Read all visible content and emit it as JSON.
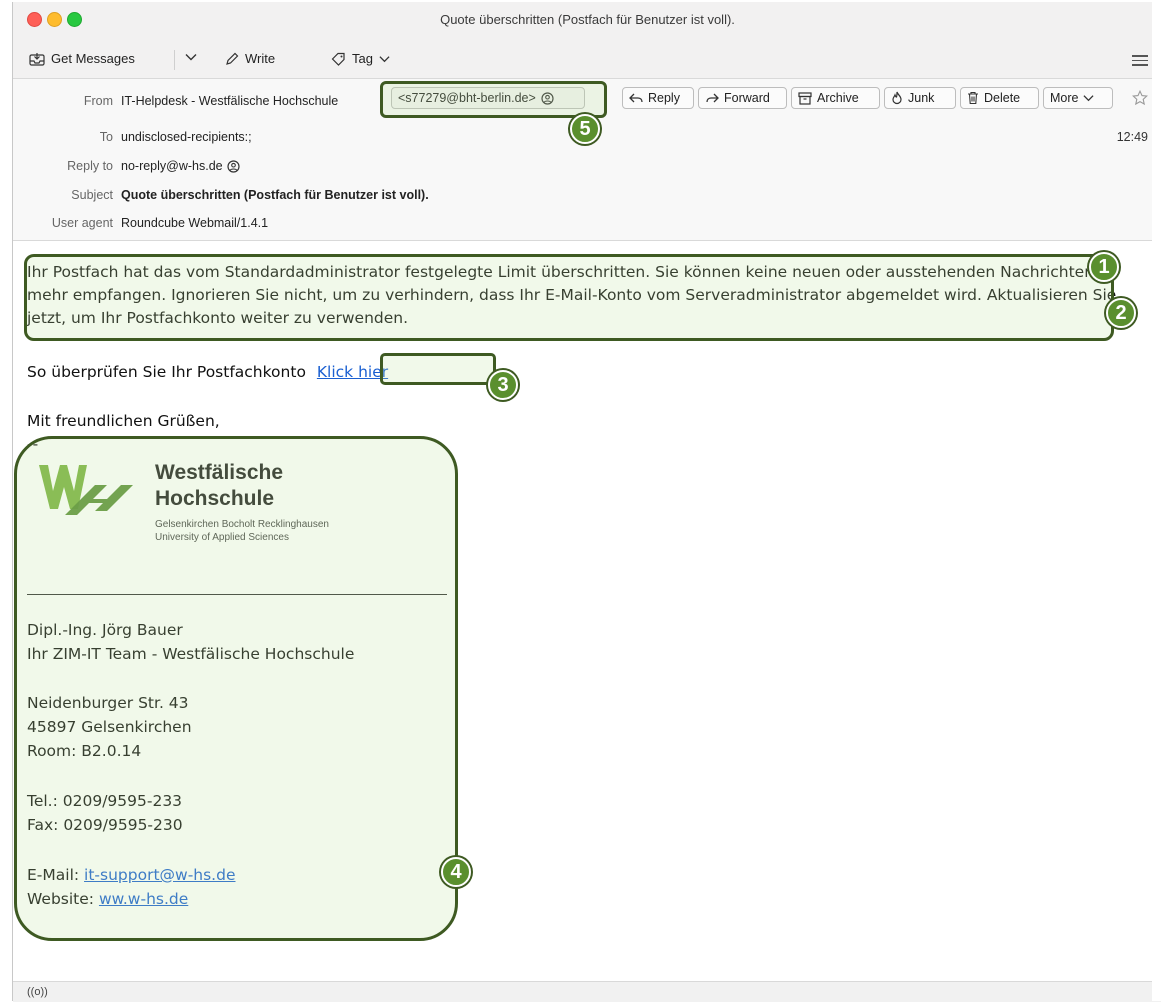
{
  "window": {
    "title": "Quote überschritten (Postfach für Benutzer ist voll)."
  },
  "toolbar": {
    "get_messages": "Get Messages",
    "write": "Write",
    "tag": "Tag"
  },
  "header": {
    "from_label": "From",
    "from_name": "IT-Helpdesk - Westfälische Hochschule",
    "from_address": "<s77279@bht-berlin.de>",
    "to_label": "To",
    "to_value": "undisclosed-recipients:;",
    "time": "12:49",
    "replyto_label": "Reply to",
    "replyto_value": "no-reply@w-hs.de",
    "subject_label": "Subject",
    "subject_value": "Quote überschritten (Postfach für Benutzer ist voll).",
    "useragent_label": "User agent",
    "useragent_value": "Roundcube Webmail/1.4.1",
    "actions": {
      "reply": "Reply",
      "forward": "Forward",
      "archive": "Archive",
      "junk": "Junk",
      "delete": "Delete",
      "more": "More"
    }
  },
  "body": {
    "paragraph": "Ihr Postfach hat das vom Standardadministrator festgelegte Limit überschritten. Sie können keine neuen oder ausstehenden Nachrichten mehr empfangen. Ignorieren Sie nicht, um zu verhindern, dass Ihr E-Mail-Konto vom Serveradministrator abgemeldet wird. Aktualisieren Sie jetzt, um Ihr Postfachkonto weiter zu verwenden.",
    "check_text": "So überprüfen Sie Ihr Postfachkonto",
    "check_link": "Klick hier",
    "greeting": "Mit freundlichen Grüßen,",
    "dash": "--"
  },
  "signature": {
    "logo_line1": "Westfälische",
    "logo_line2": "Hochschule",
    "logo_sub1": "Gelsenkirchen Bocholt Recklinghausen",
    "logo_sub2": "University of Applied Sciences",
    "name": "Dipl.-Ing. Jörg Bauer",
    "team": "Ihr ZIM-IT Team - Westfälische Hochschule",
    "street": "Neidenburger Str. 43",
    "city": "45897 Gelsenkirchen",
    "room": "Room: B2.0.14",
    "tel": "Tel.: 0209/9595-233",
    "fax": "Fax: 0209/9595-230",
    "email_label": "E-Mail:",
    "email": "it-support@w-hs.de",
    "website_label": "Website:",
    "website": "ww.w-hs.de"
  },
  "annotations": {
    "b1": "1",
    "b2": "2",
    "b3": "3",
    "b4": "4",
    "b5": "5"
  },
  "statusbar": {
    "icon": "((o))"
  },
  "colors": {
    "annotation_green": "#5a8f2e",
    "annotation_border": "#3e5a22",
    "link": "#1a5fd1"
  }
}
